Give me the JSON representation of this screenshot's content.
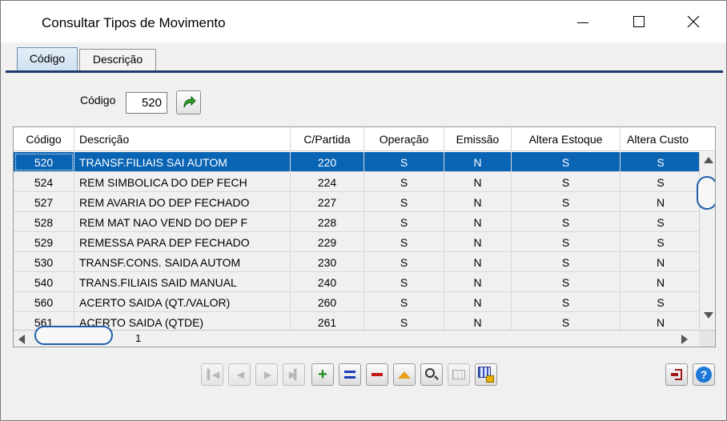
{
  "window": {
    "title": "Consultar Tipos de Movimento",
    "controls": {
      "minimize": "minimize-icon",
      "maximize": "maximize-icon",
      "close": "close-icon"
    }
  },
  "tabs": [
    {
      "label": "Código",
      "active": true
    },
    {
      "label": "Descrição",
      "active": false
    }
  ],
  "search": {
    "label": "Código",
    "value": "520",
    "go_icon": "green-arrow-icon"
  },
  "grid": {
    "columns": [
      "Código",
      "Descrição",
      "C/Partida",
      "Operação",
      "Emissão",
      "Altera Estoque",
      "Altera Custo"
    ],
    "rows": [
      {
        "codigo": "520",
        "descricao": "TRANSF.FILIAIS SAI AUTOM",
        "cpartida": "220",
        "operacao": "S",
        "emissao": "N",
        "estoque": "S",
        "custo": "S",
        "selected": true
      },
      {
        "codigo": "524",
        "descricao": "REM SIMBOLICA DO DEP FECH",
        "cpartida": "224",
        "operacao": "S",
        "emissao": "N",
        "estoque": "S",
        "custo": "S"
      },
      {
        "codigo": "527",
        "descricao": "REM AVARIA DO DEP FECHADO",
        "cpartida": "227",
        "operacao": "S",
        "emissao": "N",
        "estoque": "S",
        "custo": "N"
      },
      {
        "codigo": "528",
        "descricao": "REM MAT NAO VEND DO DEP F",
        "cpartida": "228",
        "operacao": "S",
        "emissao": "N",
        "estoque": "S",
        "custo": "S"
      },
      {
        "codigo": "529",
        "descricao": "REMESSA PARA DEP FECHADO",
        "cpartida": "229",
        "operacao": "S",
        "emissao": "N",
        "estoque": "S",
        "custo": "S"
      },
      {
        "codigo": "530",
        "descricao": "TRANSF.CONS. SAIDA AUTOM",
        "cpartida": "230",
        "operacao": "S",
        "emissao": "N",
        "estoque": "S",
        "custo": "N"
      },
      {
        "codigo": "540",
        "descricao": "TRANS.FILIAIS SAID MANUAL",
        "cpartida": "240",
        "operacao": "S",
        "emissao": "N",
        "estoque": "S",
        "custo": "N"
      },
      {
        "codigo": "560",
        "descricao": "ACERTO SAIDA (QT./VALOR)",
        "cpartida": "260",
        "operacao": "S",
        "emissao": "N",
        "estoque": "S",
        "custo": "S"
      },
      {
        "codigo": "561",
        "descricao": "ACERTO SAIDA (QTDE)",
        "cpartida": "261",
        "operacao": "S",
        "emissao": "N",
        "estoque": "S",
        "custo": "N"
      }
    ],
    "page": "1"
  },
  "toolbar": {
    "buttons": [
      "first-record-icon",
      "prev-record-icon",
      "next-record-icon",
      "last-record-icon",
      "add-icon",
      "edit-icon",
      "delete-icon",
      "up-icon",
      "search-icon",
      "grid-icon",
      "export-icon"
    ],
    "exit_icon": "exit-icon",
    "help_icon": "help-icon",
    "help_label": "?"
  },
  "colors": {
    "selected_row": "#0a64b4",
    "tab_line": "#1f3a6a",
    "add": "#1f8a1f",
    "edit": "#1a3fb8",
    "delete": "#c41818",
    "help": "#1e78d8"
  }
}
